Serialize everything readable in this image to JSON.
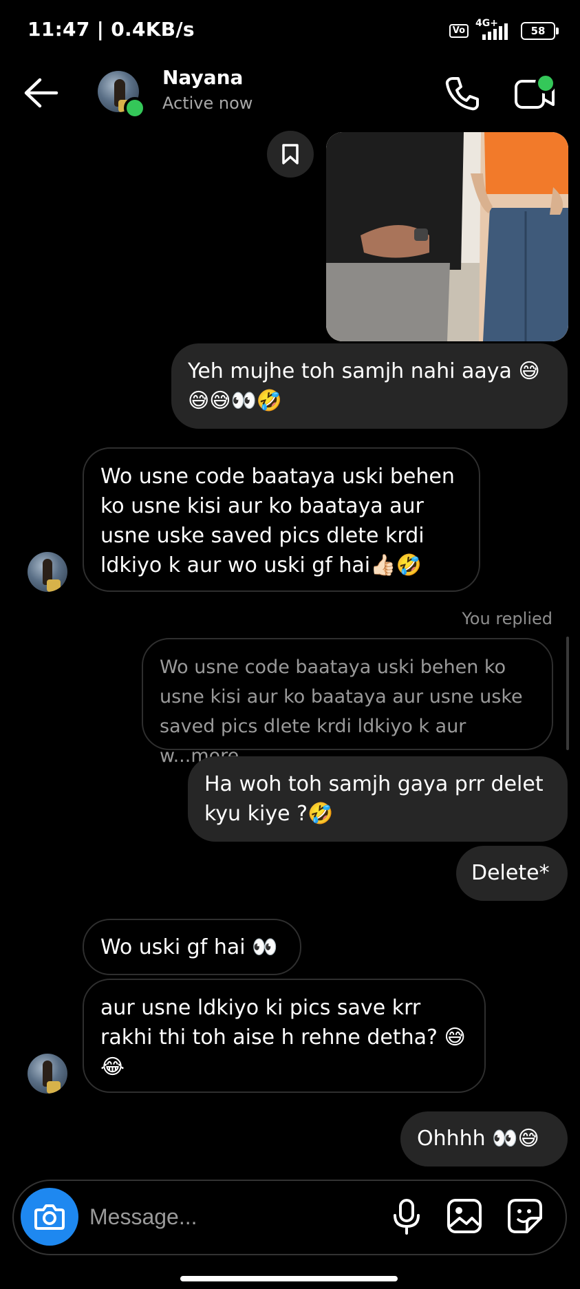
{
  "status_bar": {
    "time": "11:47 | 0.4KB/s",
    "volte": "Vo LTE",
    "network": "4G+",
    "battery": "58"
  },
  "header": {
    "name": "Nayana",
    "status": "Active now"
  },
  "messages": [
    {
      "text": "Yeh mujhe toh samjh nahi aaya 😅\n😅😅👀🤣"
    },
    {
      "text": "Wo usne code baataya uski behen\nko usne kisi aur ko baataya aur\nusne uske saved pics dlete krdi\nldkiyo k aur wo uski gf hai👍🏻🤣"
    },
    {
      "text": "Ha woh toh samjh gaya prr delet\nkyu kiye ?🤣"
    },
    {
      "text": "Delete*"
    },
    {
      "text": "Wo uski gf hai 👀"
    },
    {
      "text": "aur usne ldkiyo ki pics save krr\nrakhi thi toh aise h rehne detha? 😅\n😂"
    },
    {
      "text": "Ohhhh 👀😅"
    }
  ],
  "reply": {
    "label": "You replied",
    "preview": "Wo usne code baataya uski behen ko\nusne kisi aur ko baataya aur usne uske\nsaved pics dlete krdi ldkiyo k aur w...more"
  },
  "composer": {
    "placeholder": "Message..."
  },
  "icons": {
    "back": "back-arrow-icon",
    "call": "phone-icon",
    "video": "video-call-icon",
    "bookmark": "bookmark-icon",
    "camera": "camera-icon",
    "mic": "microphone-icon",
    "gallery": "gallery-icon",
    "sticker": "sticker-icon"
  },
  "colors": {
    "accent": "#1e88f0",
    "online": "#34c759",
    "bubble_out": "#262626",
    "background": "#000000"
  }
}
